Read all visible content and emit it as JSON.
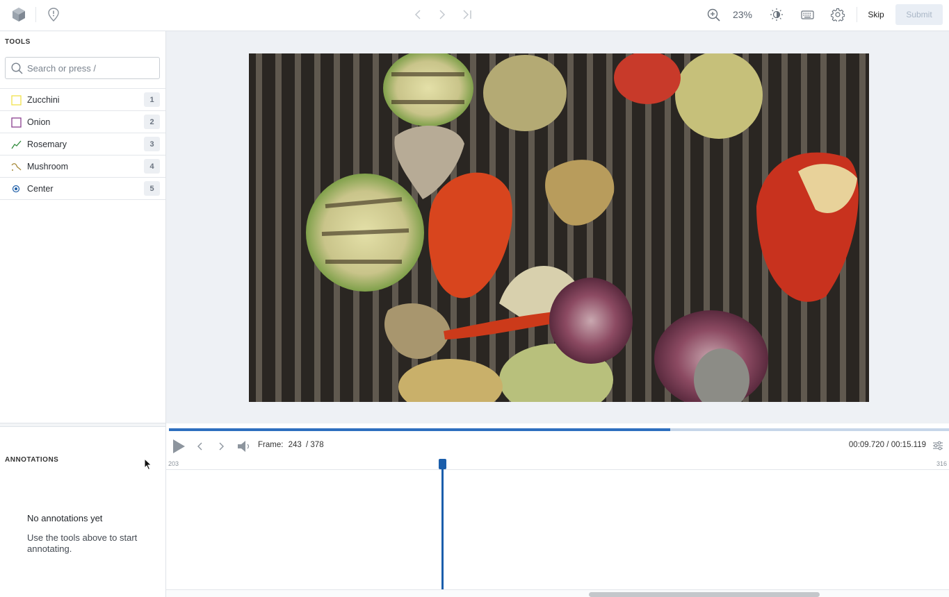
{
  "topbar": {
    "logo_icon": "cube-logo-icon",
    "issue_icon": "alert-pin-icon",
    "nav": [
      "chevron-left-icon",
      "chevron-right-icon",
      "skip-to-end-icon"
    ],
    "zoom_value": "23%",
    "skip_label": "Skip",
    "submit_label": "Submit"
  },
  "tools_panel": {
    "title": "TOOLS",
    "search_placeholder": "Search or press /",
    "items": [
      {
        "label": "Zucchini",
        "key": "1",
        "shape": "box",
        "color": "#f0e14a"
      },
      {
        "label": "Onion",
        "key": "2",
        "shape": "box",
        "color": "#8a3f8f"
      },
      {
        "label": "Rosemary",
        "key": "3",
        "shape": "polyline",
        "color": "#2f8a3b"
      },
      {
        "label": "Mushroom",
        "key": "4",
        "shape": "spline",
        "color": "#a68a3a"
      },
      {
        "label": "Center",
        "key": "5",
        "shape": "point",
        "color": "#1f5fa8"
      }
    ]
  },
  "annotations_panel": {
    "title": "ANNOTATIONS",
    "empty_title": "No annotations yet",
    "empty_text": "Use the tools above to start annotating."
  },
  "timeline": {
    "frame_label": "Frame:",
    "frame_current": "243",
    "frame_total": "/ 378",
    "time_current": "00:09.720",
    "time_total": "00:15.119",
    "time_separator": "/",
    "range_start": "203",
    "range_end": "316",
    "progress": 0.643
  },
  "colors": {
    "accent": "#2e6fbf",
    "cursor": "#1b5eab"
  }
}
